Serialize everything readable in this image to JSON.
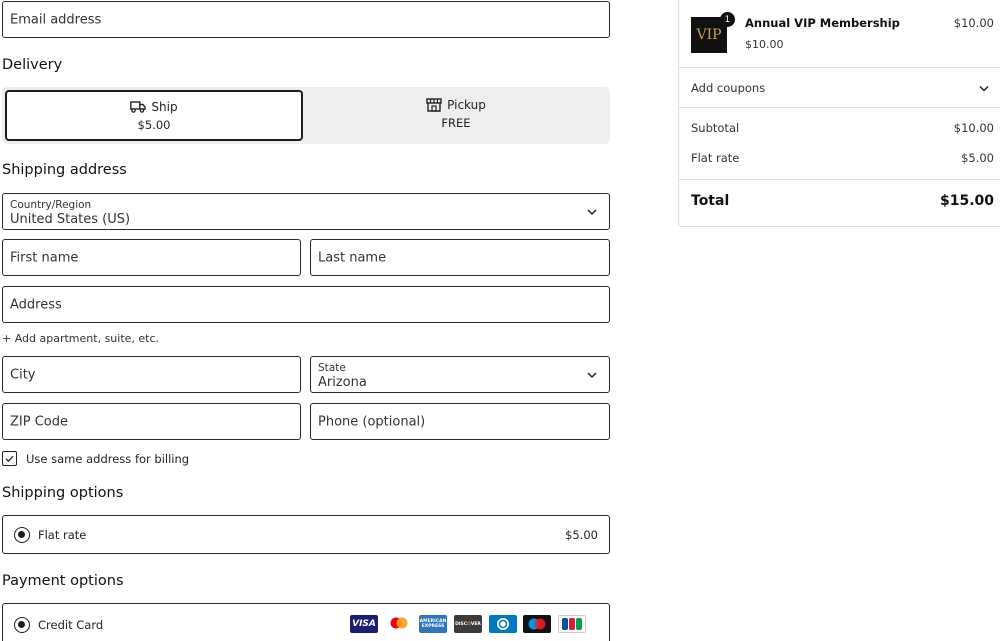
{
  "contact": {
    "email_placeholder": "Email address"
  },
  "delivery": {
    "heading": "Delivery",
    "ship_label": "Ship",
    "ship_price": "$5.00",
    "pickup_label": "Pickup",
    "pickup_price": "FREE"
  },
  "shipping_address": {
    "heading": "Shipping address",
    "country_label": "Country/Region",
    "country_value": "United States (US)",
    "first_name_placeholder": "First name",
    "last_name_placeholder": "Last name",
    "address_placeholder": "Address",
    "add_apartment_link": "+ Add apartment, suite, etc.",
    "city_placeholder": "City",
    "state_label": "State",
    "state_value": "Arizona",
    "zip_placeholder": "ZIP Code",
    "phone_placeholder": "Phone (optional)",
    "same_billing_label": "Use same address for billing",
    "same_billing_checked": true
  },
  "shipping_options": {
    "heading": "Shipping options",
    "option_label": "Flat rate",
    "option_price": "$5.00"
  },
  "payment_options": {
    "heading": "Payment options",
    "method_label": "Credit Card",
    "cards": [
      {
        "name": "VISA",
        "color": "#1a1f71"
      },
      {
        "name": "mastercard",
        "color": "#ffffff"
      },
      {
        "name": "AMERICAN EXPRESS",
        "color": "#2e77bc"
      },
      {
        "name": "DISCOVER",
        "color": "#3b3b3b"
      },
      {
        "name": "diners",
        "color": "#0079be"
      },
      {
        "name": "Maestro",
        "color": "#111111"
      },
      {
        "name": "JCB",
        "color": "#0e4c96"
      }
    ]
  },
  "order_summary": {
    "item_name": "Annual VIP Membership",
    "item_price": "$10.00",
    "item_unit_price": "$10.00",
    "item_quantity": "1",
    "item_logo_text": "VIP",
    "coupons_label": "Add coupons",
    "subtotal_label": "Subtotal",
    "subtotal_value": "$10.00",
    "flat_rate_label": "Flat rate",
    "flat_rate_value": "$5.00",
    "total_label": "Total",
    "total_value": "$15.00"
  }
}
